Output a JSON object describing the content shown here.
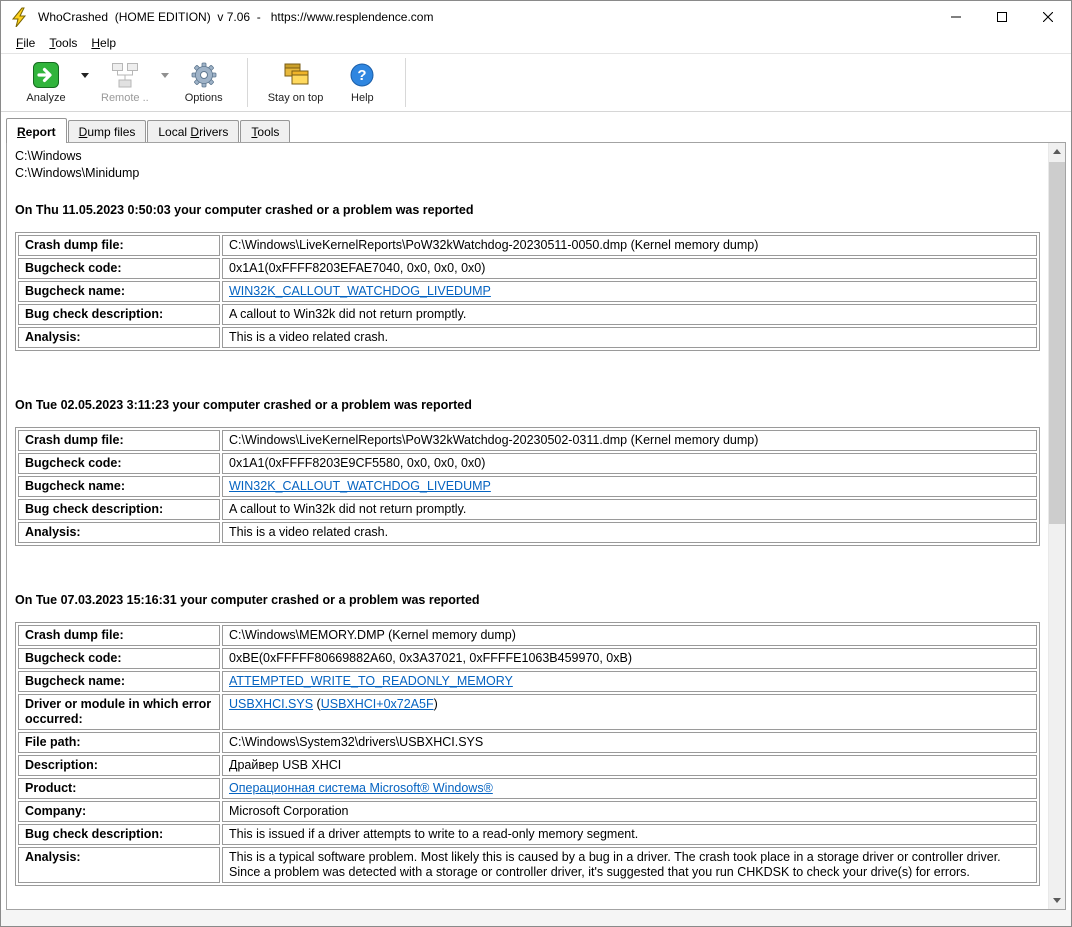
{
  "window": {
    "title": "WhoCrashed  (HOME EDITION)  v 7.06  -   https://www.resplendence.com"
  },
  "menubar": {
    "items": [
      {
        "label": "File",
        "accel": 0
      },
      {
        "label": "Tools",
        "accel": 0
      },
      {
        "label": "Help",
        "accel": 0
      }
    ]
  },
  "toolbar": {
    "buttons": [
      {
        "label": "Analyze",
        "icon": "analyze-icon",
        "enabled": true,
        "dropdown": true
      },
      {
        "label": "Remote ..",
        "icon": "remote-computers-icon",
        "enabled": false,
        "dropdown": true
      },
      {
        "label": "Options",
        "icon": "gear-icon",
        "enabled": true,
        "dropdown": false
      },
      {
        "label": "Stay on top",
        "icon": "windows-stack-icon",
        "enabled": true,
        "dropdown": false
      },
      {
        "label": "Help",
        "icon": "help-question-icon",
        "enabled": true,
        "dropdown": false
      }
    ]
  },
  "tabs": [
    {
      "label": "Report",
      "accel": 0,
      "active": true
    },
    {
      "label": "Dump files",
      "accel": 0,
      "active": false
    },
    {
      "label": "Local Drivers",
      "accel": 6,
      "active": false
    },
    {
      "label": "Tools",
      "accel": 0,
      "active": false
    }
  ],
  "report": {
    "paths": [
      "C:\\Windows",
      "C:\\Windows\\Minidump"
    ],
    "crashes": [
      {
        "heading": "On Thu 11.05.2023 0:50:03 your computer crashed or a problem was reported",
        "rows": [
          {
            "label": "Crash dump file:",
            "value": [
              {
                "t": "C:\\Windows\\LiveKernelReports\\PoW32kWatchdog-20230511-0050.dmp (Kernel memory dump)"
              }
            ]
          },
          {
            "label": "Bugcheck code:",
            "value": [
              {
                "t": "0x1A1(0xFFFF8203EFAE7040, 0x0, 0x0, 0x0)"
              }
            ]
          },
          {
            "label": "Bugcheck name:",
            "value": [
              {
                "t": "WIN32K_CALLOUT_WATCHDOG_LIVEDUMP",
                "link": true
              }
            ]
          },
          {
            "label": "Bug check description:",
            "value": [
              {
                "t": "A callout to Win32k did not return promptly."
              }
            ]
          },
          {
            "label": "Analysis:",
            "value": [
              {
                "t": "This is a video related crash."
              }
            ]
          }
        ]
      },
      {
        "heading": "On Tue 02.05.2023 3:11:23 your computer crashed or a problem was reported",
        "rows": [
          {
            "label": "Crash dump file:",
            "value": [
              {
                "t": "C:\\Windows\\LiveKernelReports\\PoW32kWatchdog-20230502-0311.dmp (Kernel memory dump)"
              }
            ]
          },
          {
            "label": "Bugcheck code:",
            "value": [
              {
                "t": "0x1A1(0xFFFF8203E9CF5580, 0x0, 0x0, 0x0)"
              }
            ]
          },
          {
            "label": "Bugcheck name:",
            "value": [
              {
                "t": "WIN32K_CALLOUT_WATCHDOG_LIVEDUMP",
                "link": true
              }
            ]
          },
          {
            "label": "Bug check description:",
            "value": [
              {
                "t": "A callout to Win32k did not return promptly."
              }
            ]
          },
          {
            "label": "Analysis:",
            "value": [
              {
                "t": "This is a video related crash."
              }
            ]
          }
        ]
      },
      {
        "heading": "On Tue 07.03.2023 15:16:31 your computer crashed or a problem was reported",
        "rows": [
          {
            "label": "Crash dump file:",
            "value": [
              {
                "t": "C:\\Windows\\MEMORY.DMP (Kernel memory dump)"
              }
            ]
          },
          {
            "label": "Bugcheck code:",
            "value": [
              {
                "t": "0xBE(0xFFFFF80669882A60, 0x3A37021, 0xFFFFE1063B459970, 0xB)"
              }
            ]
          },
          {
            "label": "Bugcheck name:",
            "value": [
              {
                "t": "ATTEMPTED_WRITE_TO_READONLY_MEMORY",
                "link": true
              }
            ]
          },
          {
            "label": "Driver or module in which error occurred:",
            "value": [
              {
                "t": "USBXHCI.SYS",
                "link": true
              },
              {
                "t": " ("
              },
              {
                "t": "USBXHCI+0x72A5F",
                "link": true
              },
              {
                "t": ")"
              }
            ]
          },
          {
            "label": "File path:",
            "value": [
              {
                "t": "C:\\Windows\\System32\\drivers\\USBXHCI.SYS"
              }
            ]
          },
          {
            "label": "Description:",
            "value": [
              {
                "t": "Драйвер USB XHCI"
              }
            ]
          },
          {
            "label": "Product:",
            "value": [
              {
                "t": "Операционная система Microsoft® Windows®",
                "link": true
              }
            ]
          },
          {
            "label": "Company:",
            "value": [
              {
                "t": "Microsoft Corporation"
              }
            ]
          },
          {
            "label": "Bug check description:",
            "value": [
              {
                "t": "This is issued if a driver attempts to write to a read-only memory segment."
              }
            ]
          },
          {
            "label": "Analysis:",
            "value": [
              {
                "t": "This is a typical software problem. Most likely this is caused by a bug in a driver. The crash took place in a storage driver or controller driver. Since a problem was detected with a storage or controller driver, it's suggested that you run CHKDSK to check your drive(s) for errors."
              }
            ]
          }
        ]
      }
    ]
  },
  "colors": {
    "link": "#0563C1",
    "analyze_green": "#31b43c",
    "help_blue": "#2f86e0",
    "stay_on_top_yellow": "#ffd95e",
    "scrollbar_track": "#f0f0f0",
    "scrollbar_thumb": "#cdcdcd"
  }
}
